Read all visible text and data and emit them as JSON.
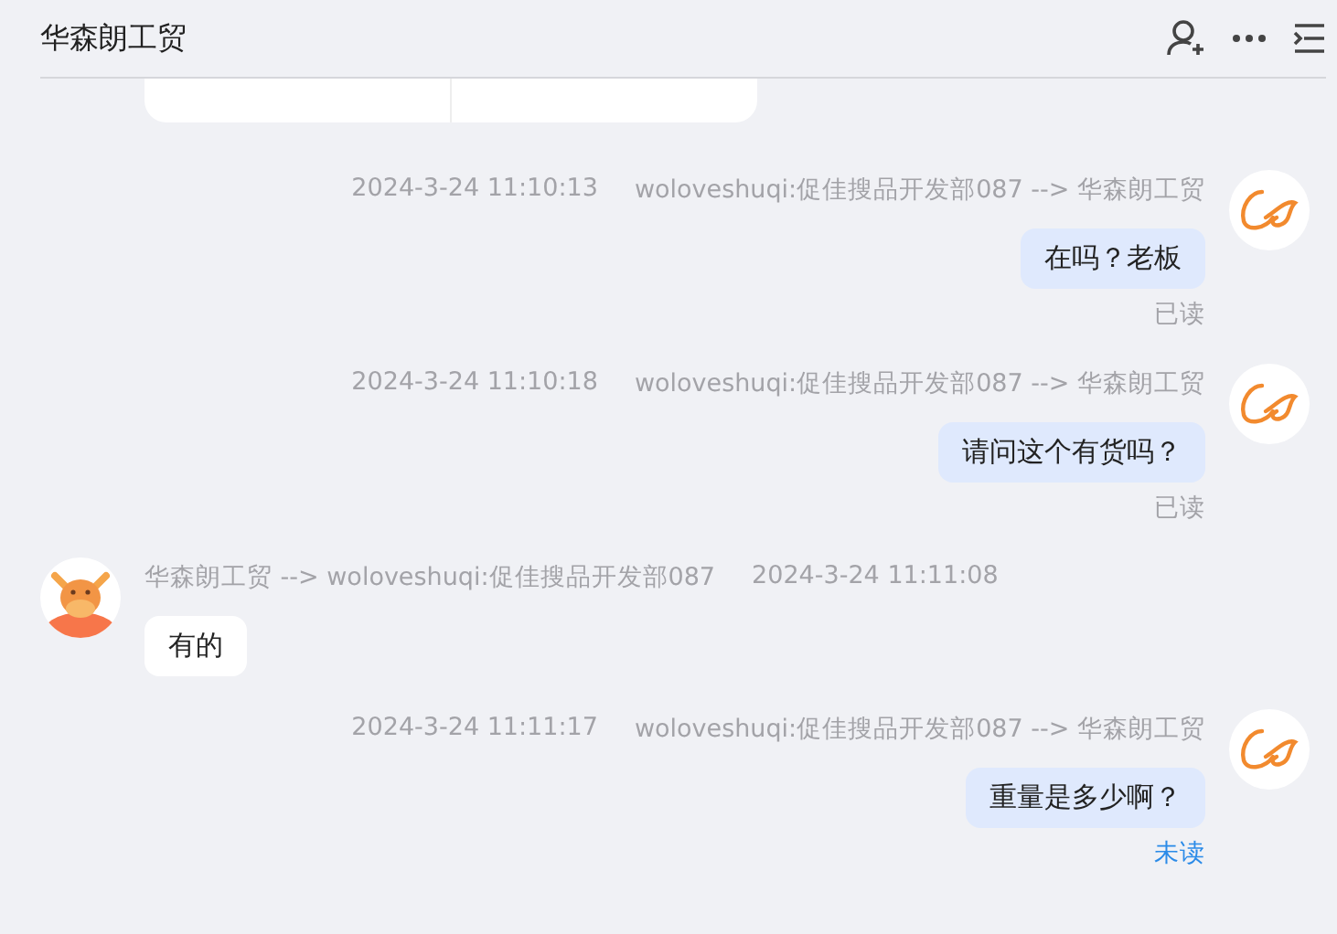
{
  "header": {
    "title": "华森朗工贸"
  },
  "messages": [
    {
      "kind": "sent",
      "time": "2024-3-24 11:10:13",
      "route": "woloveshuqi:促佳搜品开发部087 --> 华森朗工贸",
      "text": "在吗？老板",
      "status": "已读",
      "read": true
    },
    {
      "kind": "sent",
      "time": "2024-3-24 11:10:18",
      "route": "woloveshuqi:促佳搜品开发部087 --> 华森朗工贸",
      "text": "请问这个有货吗？",
      "status": "已读",
      "read": true
    },
    {
      "kind": "received",
      "time": "2024-3-24 11:11:08",
      "route": "华森朗工贸 --> woloveshuqi:促佳搜品开发部087",
      "text": "有的"
    },
    {
      "kind": "sent",
      "time": "2024-3-24 11:11:17",
      "route": "woloveshuqi:促佳搜品开发部087 --> 华森朗工贸",
      "text": "重量是多少啊？",
      "status": "未读",
      "read": false
    }
  ]
}
